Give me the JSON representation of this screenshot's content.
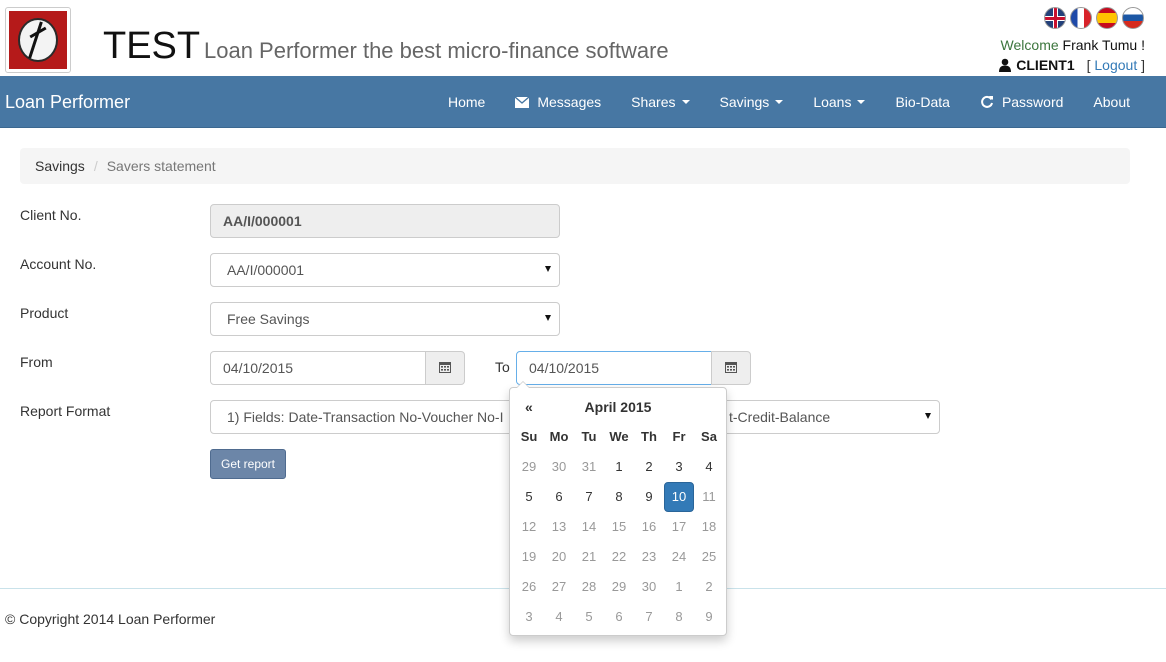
{
  "header": {
    "title": "TEST",
    "subtitle": "Loan Performer the best micro-finance software",
    "welcome_label": "Welcome",
    "user_name": "Frank Tumu !",
    "username": "CLIENT1",
    "logout_open": "[",
    "logout_label": "Logout",
    "logout_close": "]",
    "flags": [
      "uk-flag-icon",
      "france-flag-icon",
      "spain-flag-icon",
      "russia-flag-icon"
    ]
  },
  "navbar": {
    "brand": "Loan Performer",
    "items": [
      {
        "label": "Home",
        "icon": "",
        "dropdown": false
      },
      {
        "label": "Messages",
        "icon": "envelope-icon",
        "dropdown": false
      },
      {
        "label": "Shares",
        "icon": "",
        "dropdown": true
      },
      {
        "label": "Savings",
        "icon": "",
        "dropdown": true
      },
      {
        "label": "Loans",
        "icon": "",
        "dropdown": true
      },
      {
        "label": "Bio-Data",
        "icon": "",
        "dropdown": false
      },
      {
        "label": "Password",
        "icon": "refresh-icon",
        "dropdown": false
      },
      {
        "label": "About",
        "icon": "",
        "dropdown": false
      }
    ],
    "background": "#4777a3"
  },
  "breadcrumb": {
    "items": [
      "Savings",
      "Savers statement"
    ],
    "separator": "/"
  },
  "form": {
    "client_no_label": "Client No.",
    "client_no_value": "AA/I/000001",
    "account_no_label": "Account No.",
    "account_no_value": "AA/I/000001",
    "product_label": "Product",
    "product_value": "Free Savings",
    "from_label": "From",
    "from_value": "04/10/2015",
    "to_label": "To",
    "to_value": "04/10/2015",
    "report_format_label": "Report Format",
    "report_format_left": "1) Fields: Date-Transaction No-Voucher No-I",
    "report_format_right": "t-Credit-Balance",
    "get_report_label": "Get report"
  },
  "datepicker": {
    "prev": "«",
    "title": "April 2015",
    "weekdays": [
      "Su",
      "Mo",
      "Tu",
      "We",
      "Th",
      "Fr",
      "Sa"
    ],
    "weeks": [
      [
        {
          "d": "29",
          "o": true
        },
        {
          "d": "30",
          "o": true
        },
        {
          "d": "31",
          "o": true
        },
        {
          "d": "1"
        },
        {
          "d": "2"
        },
        {
          "d": "3"
        },
        {
          "d": "4"
        }
      ],
      [
        {
          "d": "5"
        },
        {
          "d": "6"
        },
        {
          "d": "7"
        },
        {
          "d": "8"
        },
        {
          "d": "9"
        },
        {
          "d": "10",
          "active": true
        },
        {
          "d": "11",
          "o": true
        }
      ],
      [
        {
          "d": "12",
          "o": true
        },
        {
          "d": "13",
          "o": true
        },
        {
          "d": "14",
          "o": true
        },
        {
          "d": "15",
          "o": true
        },
        {
          "d": "16",
          "o": true
        },
        {
          "d": "17",
          "o": true
        },
        {
          "d": "18",
          "o": true
        }
      ],
      [
        {
          "d": "19",
          "o": true
        },
        {
          "d": "20",
          "o": true
        },
        {
          "d": "21",
          "o": true
        },
        {
          "d": "22",
          "o": true
        },
        {
          "d": "23",
          "o": true
        },
        {
          "d": "24",
          "o": true
        },
        {
          "d": "25",
          "o": true
        }
      ],
      [
        {
          "d": "26",
          "o": true
        },
        {
          "d": "27",
          "o": true
        },
        {
          "d": "28",
          "o": true
        },
        {
          "d": "29",
          "o": true
        },
        {
          "d": "30",
          "o": true
        },
        {
          "d": "1",
          "o": true
        },
        {
          "d": "2",
          "o": true
        }
      ],
      [
        {
          "d": "3",
          "o": true
        },
        {
          "d": "4",
          "o": true
        },
        {
          "d": "5",
          "o": true
        },
        {
          "d": "6",
          "o": true
        },
        {
          "d": "7",
          "o": true
        },
        {
          "d": "8",
          "o": true
        },
        {
          "d": "9",
          "o": true
        }
      ]
    ],
    "active_color": "#337ab7"
  },
  "footer": {
    "copyright": "© Copyright 2014 Loan Performer"
  }
}
